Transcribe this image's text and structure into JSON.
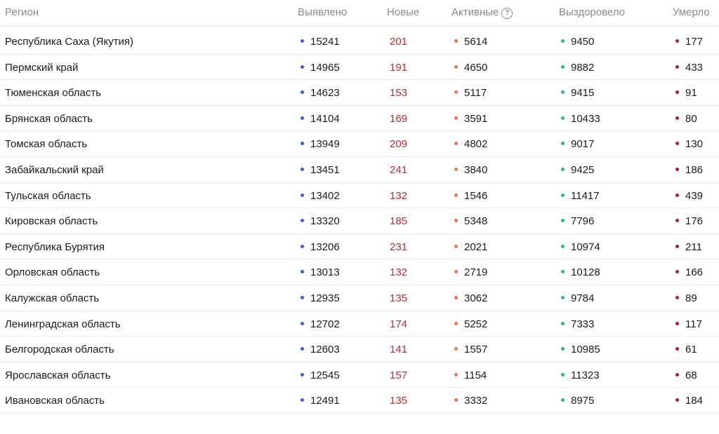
{
  "colors": {
    "found": "#3b5bdb",
    "new": "#c0282d",
    "active": "#e8734a",
    "recovered": "#1fb89a",
    "died": "#b01e2a"
  },
  "header": {
    "region": "Регион",
    "found": "Выявлено",
    "new": "Новые",
    "active": "Активные",
    "active_help": "?",
    "recovered": "Выздоровело",
    "died": "Умерло"
  },
  "rows": [
    {
      "region": "Республика Саха (Якутия)",
      "found": "15241",
      "new": "201",
      "active": "5614",
      "recovered": "9450",
      "died": "177"
    },
    {
      "region": "Пермский край",
      "found": "14965",
      "new": "191",
      "active": "4650",
      "recovered": "9882",
      "died": "433"
    },
    {
      "region": "Тюменская область",
      "found": "14623",
      "new": "153",
      "active": "5117",
      "recovered": "9415",
      "died": "91"
    },
    {
      "region": "Брянская область",
      "found": "14104",
      "new": "169",
      "active": "3591",
      "recovered": "10433",
      "died": "80"
    },
    {
      "region": "Томская область",
      "found": "13949",
      "new": "209",
      "active": "4802",
      "recovered": "9017",
      "died": "130"
    },
    {
      "region": "Забайкальский край",
      "found": "13451",
      "new": "241",
      "active": "3840",
      "recovered": "9425",
      "died": "186"
    },
    {
      "region": "Тульская область",
      "found": "13402",
      "new": "132",
      "active": "1546",
      "recovered": "11417",
      "died": "439"
    },
    {
      "region": "Кировская область",
      "found": "13320",
      "new": "185",
      "active": "5348",
      "recovered": "7796",
      "died": "176"
    },
    {
      "region": "Республика Бурятия",
      "found": "13206",
      "new": "231",
      "active": "2021",
      "recovered": "10974",
      "died": "211"
    },
    {
      "region": "Орловская область",
      "found": "13013",
      "new": "132",
      "active": "2719",
      "recovered": "10128",
      "died": "166"
    },
    {
      "region": "Калужская область",
      "found": "12935",
      "new": "135",
      "active": "3062",
      "recovered": "9784",
      "died": "89"
    },
    {
      "region": "Ленинградская область",
      "found": "12702",
      "new": "174",
      "active": "5252",
      "recovered": "7333",
      "died": "117"
    },
    {
      "region": "Белгородская область",
      "found": "12603",
      "new": "141",
      "active": "1557",
      "recovered": "10985",
      "died": "61"
    },
    {
      "region": "Ярославская область",
      "found": "12545",
      "new": "157",
      "active": "1154",
      "recovered": "11323",
      "died": "68"
    },
    {
      "region": "Ивановская область",
      "found": "12491",
      "new": "135",
      "active": "3332",
      "recovered": "8975",
      "died": "184"
    }
  ]
}
